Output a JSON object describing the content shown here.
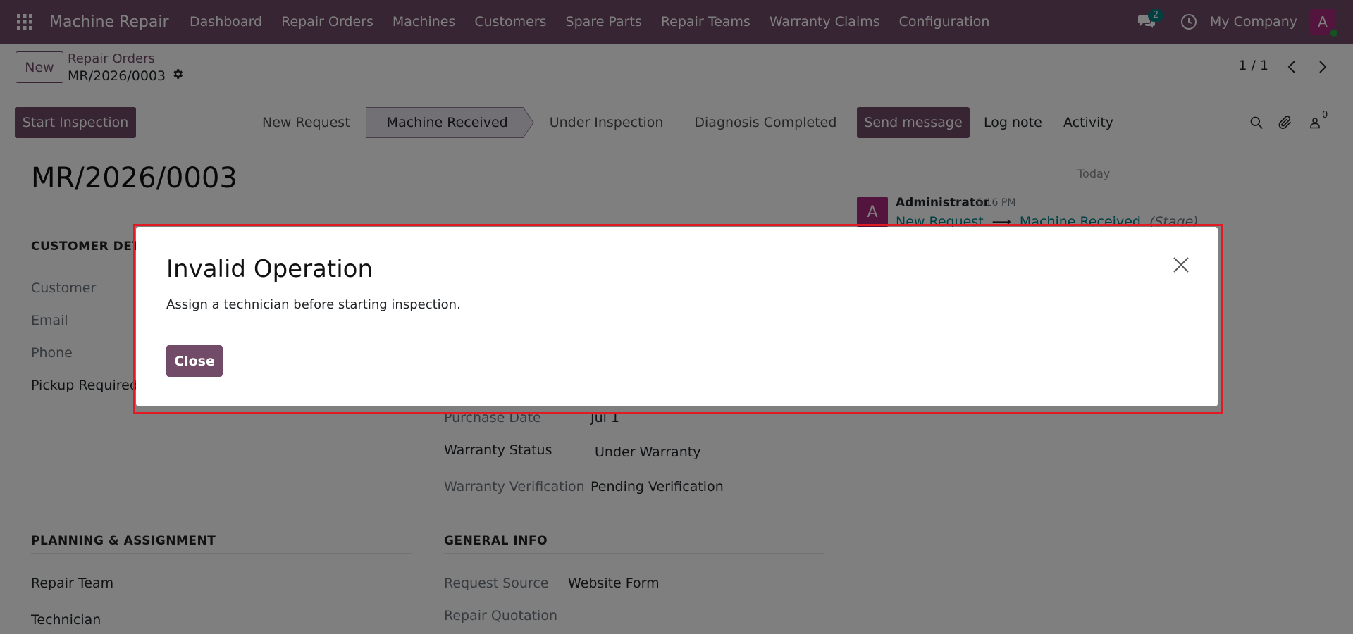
{
  "navbar": {
    "brand": "Machine Repair",
    "menu": [
      "Dashboard",
      "Repair Orders",
      "Machines",
      "Customers",
      "Spare Parts",
      "Repair Teams",
      "Warranty Claims",
      "Configuration"
    ],
    "messages_badge": "2",
    "company": "My Company",
    "avatar_letter": "A"
  },
  "control_panel": {
    "new_label": "New",
    "breadcrumb_parent": "Repair Orders",
    "breadcrumb_current": "MR/2026/0003",
    "pager": "1 / 1"
  },
  "statusbar": {
    "action_button": "Start Inspection",
    "stages": [
      "New Request",
      "Machine Received",
      "Under Inspection",
      "Diagnosis Completed"
    ],
    "active_stage": "Machine Received",
    "more": "..."
  },
  "chatter": {
    "send_message": "Send message",
    "log_note": "Log note",
    "activity": "Activity",
    "followers_count": "0",
    "date_separator": "Today",
    "message": {
      "avatar": "A",
      "author": "Administrator",
      "time": "6:16 PM",
      "old_value": "New Request",
      "arrow": "⟶",
      "new_value": "Machine Received",
      "field": "(Stage)"
    }
  },
  "form": {
    "title": "MR/2026/0003",
    "customer_section": "CUSTOMER DETAILS",
    "customer_label": "Customer",
    "email_label": "Email",
    "phone_label": "Phone",
    "pickup_label": "Pickup Required",
    "purchase_date_label": "Purchase Date",
    "purchase_date_value": "Jul 1",
    "warranty_status_label": "Warranty Status",
    "warranty_status_value": "Under Warranty",
    "warranty_verification_label": "Warranty Verification",
    "warranty_verification_value": "Pending Verification",
    "planning_section": "PLANNING & ASSIGNMENT",
    "repair_team_label": "Repair Team",
    "technician_label": "Technician",
    "general_section": "GENERAL INFO",
    "request_source_label": "Request Source",
    "request_source_value": "Website Form",
    "repair_quotation_label": "Repair Quotation"
  },
  "modal": {
    "title": "Invalid Operation",
    "body": "Assign a technician before starting inspection.",
    "close_button": "Close"
  },
  "colors": {
    "brand": "#714B67",
    "badge": "#017E84",
    "avatar": "#A62A7C",
    "highlight": "#e01b24"
  }
}
